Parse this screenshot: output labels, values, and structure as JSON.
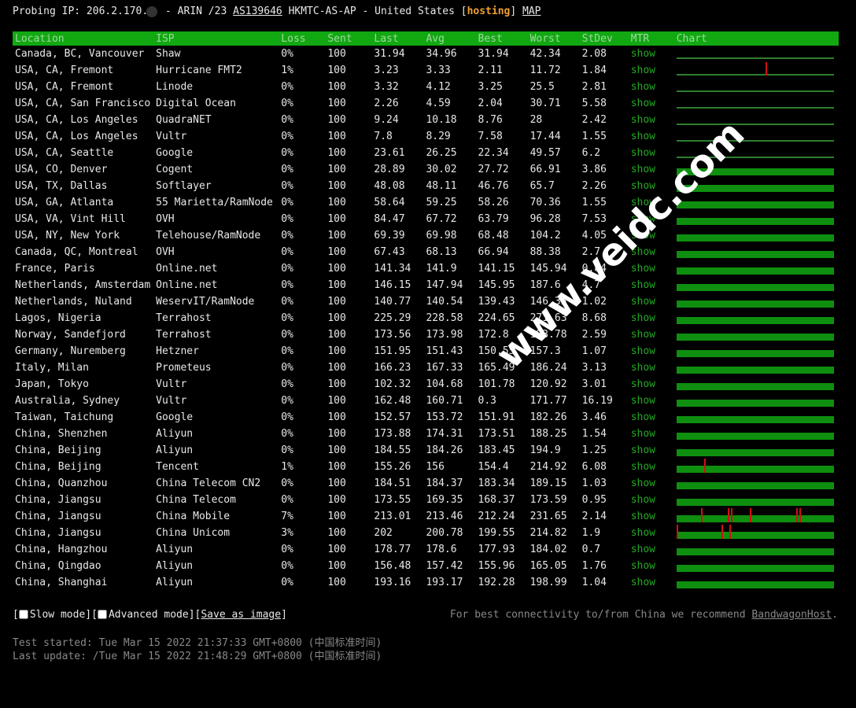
{
  "header": {
    "probe_label": "Probing IP: 206.2.170.",
    "rir": "- ARIN /23",
    "asn": "AS139646",
    "asname": "HKMTC-AS-AP - United States",
    "hosting": "hosting",
    "map": "MAP"
  },
  "columns": [
    "Location",
    "ISP",
    "Loss",
    "Sent",
    "Last",
    "Avg",
    "Best",
    "Worst",
    "StDev",
    "MTR",
    "Chart"
  ],
  "mtr_label": "show",
  "rows": [
    {
      "location": "Canada, BC, Vancouver",
      "isp": "Shaw",
      "loss": "0%",
      "sent": "100",
      "last": "31.94",
      "avg": "34.96",
      "best": "31.94",
      "worst": "42.34",
      "stdev": "2.08",
      "chart": "thin",
      "spikes": []
    },
    {
      "location": "USA, CA, Fremont",
      "isp": "Hurricane FMT2",
      "loss": "1%",
      "sent": "100",
      "last": "3.23",
      "avg": "3.33",
      "best": "2.11",
      "worst": "11.72",
      "stdev": "1.84",
      "chart": "thin",
      "spikes": [
        0.57
      ]
    },
    {
      "location": "USA, CA, Fremont",
      "isp": "Linode",
      "loss": "0%",
      "sent": "100",
      "last": "3.32",
      "avg": "4.12",
      "best": "3.25",
      "worst": "25.5",
      "stdev": "2.81",
      "chart": "thin",
      "spikes": []
    },
    {
      "location": "USA, CA, San Francisco",
      "isp": "Digital Ocean",
      "loss": "0%",
      "sent": "100",
      "last": "2.26",
      "avg": "4.59",
      "best": "2.04",
      "worst": "30.71",
      "stdev": "5.58",
      "chart": "thin",
      "spikes": []
    },
    {
      "location": "USA, CA, Los Angeles",
      "isp": "QuadraNET",
      "loss": "0%",
      "sent": "100",
      "last": "9.24",
      "avg": "10.18",
      "best": "8.76",
      "worst": "28",
      "stdev": "2.42",
      "chart": "thin",
      "spikes": []
    },
    {
      "location": "USA, CA, Los Angeles",
      "isp": "Vultr",
      "loss": "0%",
      "sent": "100",
      "last": "7.8",
      "avg": "8.29",
      "best": "7.58",
      "worst": "17.44",
      "stdev": "1.55",
      "chart": "thin",
      "spikes": []
    },
    {
      "location": "USA, CA, Seattle",
      "isp": "Google",
      "loss": "0%",
      "sent": "100",
      "last": "23.61",
      "avg": "26.25",
      "best": "22.34",
      "worst": "49.57",
      "stdev": "6.2",
      "chart": "thin",
      "spikes": []
    },
    {
      "location": "USA, CO, Denver",
      "isp": "Cogent",
      "loss": "0%",
      "sent": "100",
      "last": "28.89",
      "avg": "30.02",
      "best": "27.72",
      "worst": "66.91",
      "stdev": "3.86",
      "chart": "full",
      "spikes": []
    },
    {
      "location": "USA, TX, Dallas",
      "isp": "Softlayer",
      "loss": "0%",
      "sent": "100",
      "last": "48.08",
      "avg": "48.11",
      "best": "46.76",
      "worst": "65.7",
      "stdev": "2.26",
      "chart": "full",
      "spikes": []
    },
    {
      "location": "USA, GA, Atlanta",
      "isp": "55 Marietta/RamNode",
      "loss": "0%",
      "sent": "100",
      "last": "58.64",
      "avg": "59.25",
      "best": "58.26",
      "worst": "70.36",
      "stdev": "1.55",
      "chart": "full",
      "spikes": []
    },
    {
      "location": "USA, VA, Vint Hill",
      "isp": "OVH",
      "loss": "0%",
      "sent": "100",
      "last": "84.47",
      "avg": "67.72",
      "best": "63.79",
      "worst": "96.28",
      "stdev": "7.53",
      "chart": "full",
      "spikes": []
    },
    {
      "location": "USA, NY, New York",
      "isp": "Telehouse/RamNode",
      "loss": "0%",
      "sent": "100",
      "last": "69.39",
      "avg": "69.98",
      "best": "68.48",
      "worst": "104.2",
      "stdev": "4.05",
      "chart": "full",
      "spikes": []
    },
    {
      "location": "Canada, QC, Montreal",
      "isp": "OVH",
      "loss": "0%",
      "sent": "100",
      "last": "67.43",
      "avg": "68.13",
      "best": "66.94",
      "worst": "88.38",
      "stdev": "2.7",
      "chart": "full",
      "spikes": []
    },
    {
      "location": "France, Paris",
      "isp": "Online.net",
      "loss": "0%",
      "sent": "100",
      "last": "141.34",
      "avg": "141.9",
      "best": "141.15",
      "worst": "145.94",
      "stdev": "0.84",
      "chart": "full",
      "spikes": []
    },
    {
      "location": "Netherlands, Amsterdam",
      "isp": "Online.net",
      "loss": "0%",
      "sent": "100",
      "last": "146.15",
      "avg": "147.94",
      "best": "145.95",
      "worst": "187.6",
      "stdev": "4.7",
      "chart": "full",
      "spikes": []
    },
    {
      "location": "Netherlands, Nuland",
      "isp": "WeservIT/RamNode",
      "loss": "0%",
      "sent": "100",
      "last": "140.77",
      "avg": "140.54",
      "best": "139.43",
      "worst": "146.35",
      "stdev": "1.02",
      "chart": "full",
      "spikes": []
    },
    {
      "location": "Lagos, Nigeria",
      "isp": "Terrahost",
      "loss": "0%",
      "sent": "100",
      "last": "225.29",
      "avg": "228.58",
      "best": "224.65",
      "worst": "271.63",
      "stdev": "8.68",
      "chart": "full",
      "spikes": []
    },
    {
      "location": "Norway, Sandefjord",
      "isp": "Terrahost",
      "loss": "0%",
      "sent": "100",
      "last": "173.56",
      "avg": "173.98",
      "best": "172.8",
      "worst": "193.78",
      "stdev": "2.59",
      "chart": "full",
      "spikes": []
    },
    {
      "location": "Germany, Nuremberg",
      "isp": "Hetzner",
      "loss": "0%",
      "sent": "100",
      "last": "151.95",
      "avg": "151.43",
      "best": "150.55",
      "worst": "157.3",
      "stdev": "1.07",
      "chart": "full",
      "spikes": []
    },
    {
      "location": "Italy, Milan",
      "isp": "Prometeus",
      "loss": "0%",
      "sent": "100",
      "last": "166.23",
      "avg": "167.33",
      "best": "165.49",
      "worst": "186.24",
      "stdev": "3.13",
      "chart": "full",
      "spikes": []
    },
    {
      "location": "Japan, Tokyo",
      "isp": "Vultr",
      "loss": "0%",
      "sent": "100",
      "last": "102.32",
      "avg": "104.68",
      "best": "101.78",
      "worst": "120.92",
      "stdev": "3.01",
      "chart": "full",
      "spikes": []
    },
    {
      "location": "Australia, Sydney",
      "isp": "Vultr",
      "loss": "0%",
      "sent": "100",
      "last": "162.48",
      "avg": "160.71",
      "best": "0.3",
      "worst": "171.77",
      "stdev": "16.19",
      "chart": "full",
      "spikes": []
    },
    {
      "location": "Taiwan, Taichung",
      "isp": "Google",
      "loss": "0%",
      "sent": "100",
      "last": "152.57",
      "avg": "153.72",
      "best": "151.91",
      "worst": "182.26",
      "stdev": "3.46",
      "chart": "full",
      "spikes": []
    },
    {
      "location": "China, Shenzhen",
      "isp": "Aliyun",
      "loss": "0%",
      "sent": "100",
      "last": "173.88",
      "avg": "174.31",
      "best": "173.51",
      "worst": "188.25",
      "stdev": "1.54",
      "chart": "full",
      "spikes": []
    },
    {
      "location": "China, Beijing",
      "isp": "Aliyun",
      "loss": "0%",
      "sent": "100",
      "last": "184.55",
      "avg": "184.26",
      "best": "183.45",
      "worst": "194.9",
      "stdev": "1.25",
      "chart": "full",
      "spikes": []
    },
    {
      "location": "China, Beijing",
      "isp": "Tencent",
      "loss": "1%",
      "sent": "100",
      "last": "155.26",
      "avg": "156",
      "best": "154.4",
      "worst": "214.92",
      "stdev": "6.08",
      "chart": "full",
      "spikes": [
        0.18
      ]
    },
    {
      "location": "China, Quanzhou",
      "isp": "China Telecom CN2",
      "loss": "0%",
      "sent": "100",
      "last": "184.51",
      "avg": "184.37",
      "best": "183.34",
      "worst": "189.15",
      "stdev": "1.03",
      "chart": "full",
      "spikes": []
    },
    {
      "location": "China, Jiangsu",
      "isp": "China Telecom",
      "loss": "0%",
      "sent": "100",
      "last": "173.55",
      "avg": "169.35",
      "best": "168.37",
      "worst": "173.59",
      "stdev": "0.95",
      "chart": "full",
      "spikes": []
    },
    {
      "location": "China, Jiangsu",
      "isp": "China Mobile",
      "loss": "7%",
      "sent": "100",
      "last": "213.01",
      "avg": "213.46",
      "best": "212.24",
      "worst": "231.65",
      "stdev": "2.14",
      "chart": "full",
      "spikes": [
        0.16,
        0.33,
        0.35,
        0.47,
        0.77,
        0.79
      ]
    },
    {
      "location": "China, Jiangsu",
      "isp": "China Unicom",
      "loss": "3%",
      "sent": "100",
      "last": "202",
      "avg": "200.78",
      "best": "199.55",
      "worst": "214.82",
      "stdev": "1.9",
      "chart": "full",
      "spikes": [
        0.0,
        0.29,
        0.34
      ]
    },
    {
      "location": "China, Hangzhou",
      "isp": "Aliyun",
      "loss": "0%",
      "sent": "100",
      "last": "178.77",
      "avg": "178.6",
      "best": "177.93",
      "worst": "184.02",
      "stdev": "0.7",
      "chart": "full",
      "spikes": []
    },
    {
      "location": "China, Qingdao",
      "isp": "Aliyun",
      "loss": "0%",
      "sent": "100",
      "last": "156.48",
      "avg": "157.42",
      "best": "155.96",
      "worst": "165.05",
      "stdev": "1.76",
      "chart": "full",
      "spikes": []
    },
    {
      "location": "China, Shanghai",
      "isp": "Aliyun",
      "loss": "0%",
      "sent": "100",
      "last": "193.16",
      "avg": "193.17",
      "best": "192.28",
      "worst": "198.99",
      "stdev": "1.04",
      "chart": "full",
      "spikes": []
    }
  ],
  "footer": {
    "slow_mode": "Slow mode",
    "advanced_mode": "Advanced mode",
    "save_image": "Save as image",
    "recommend_prefix": "For best connectivity to/from China we recommend",
    "recommend_link": "BandwagonHost",
    "recommend_suffix": ".",
    "test_started": "Test started: Tue Mar 15 2022 21:37:33 GMT+0800 (中国标准时间)",
    "last_update": "Last update: /Tue Mar 15 2022 21:48:29 GMT+0800 (中国标准时间)"
  },
  "watermark": "www.veidc.com",
  "colors": {
    "header_bg": "#12a812",
    "hosting": "#f0a030",
    "mtr_link": "#22aa22",
    "chart_ok": "#0f8f0f",
    "chart_loss": "#d01010"
  }
}
